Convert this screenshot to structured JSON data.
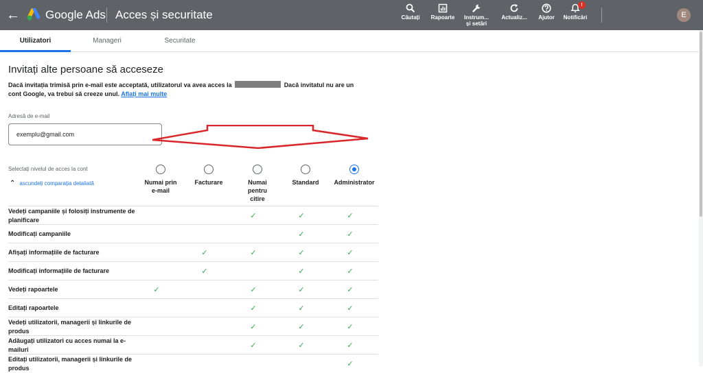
{
  "header": {
    "brand": "Google Ads",
    "title": "Acces și securitate",
    "tools": [
      {
        "label": "Căutați",
        "icon": "search-icon"
      },
      {
        "label": "Rapoarte",
        "icon": "reports-icon"
      },
      {
        "label": "Instrum... și setări",
        "icon": "wrench-icon"
      },
      {
        "label": "Actualiz...",
        "icon": "refresh-icon"
      },
      {
        "label": "Ajutor",
        "icon": "help-icon"
      },
      {
        "label": "Notificări",
        "icon": "bell-icon",
        "badge": "!"
      }
    ],
    "avatar": "E"
  },
  "tabs": [
    "Utilizatori",
    "Manageri",
    "Securitate"
  ],
  "invite": {
    "title": "Invitați alte persoane să acceseze",
    "text_before": "Dacă invitația trimisă prin e-mail este acceptată, utilizatorul va avea acces la",
    "text_after": "Dacă invitatul nu are un cont Google, va trebui să creeze unul.",
    "link": "Aflați mai multe"
  },
  "email": {
    "label": "Adresă de e-mail",
    "value": "exemplu@gmail.com"
  },
  "access": {
    "label": "Selectați nivelul de acces la cont",
    "toggle": "ascundeți comparația detaliată",
    "levels": [
      "Numai prin e-mail",
      "Facturare",
      "Numai pentru citire",
      "Standard",
      "Administrator"
    ],
    "selected_level": "Administrator"
  },
  "permissions": [
    {
      "label": "Vedeți campaniile și folosiți instrumente de planificare",
      "levels": [
        "Numai pentru citire",
        "Standard",
        "Administrator"
      ]
    },
    {
      "label": "Modificați campaniile",
      "levels": [
        "Standard",
        "Administrator"
      ]
    },
    {
      "label": "Afișați informațiile de facturare",
      "levels": [
        "Facturare",
        "Numai pentru citire",
        "Standard",
        "Administrator"
      ]
    },
    {
      "label": "Modificați informațiile de facturare",
      "levels": [
        "Facturare",
        "Standard",
        "Administrator"
      ]
    },
    {
      "label": "Vedeți rapoartele",
      "levels": [
        "Numai prin e-mail",
        "Numai pentru citire",
        "Standard",
        "Administrator"
      ]
    },
    {
      "label": "Editați rapoartele",
      "levels": [
        "Numai pentru citire",
        "Standard",
        "Administrator"
      ]
    },
    {
      "label": "Vedeți utilizatorii, managerii și linkurile de produs",
      "levels": [
        "Numai pentru citire",
        "Standard",
        "Administrator"
      ]
    },
    {
      "label": "Adăugați utilizatori cu acces numai la e-mailuri",
      "levels": [
        "Numai pentru citire",
        "Standard",
        "Administrator"
      ]
    },
    {
      "label": "Editați utilizatorii, managerii și linkurile de produs",
      "levels": [
        "Administrator"
      ]
    }
  ],
  "colors": {
    "topbar": "#5f6368",
    "accent": "#1a73e8",
    "check": "#34a853",
    "annotation": "#d9262b"
  }
}
